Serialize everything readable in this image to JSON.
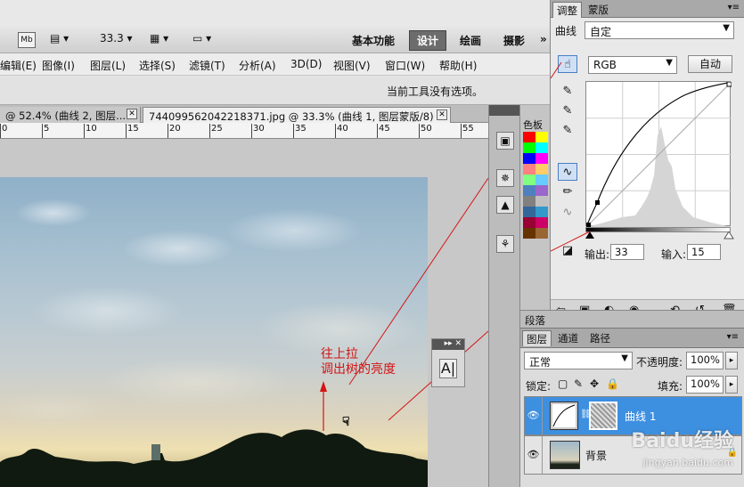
{
  "app": {
    "mb_badge": "Mb",
    "zoom": "33.3",
    "workspaces": [
      "基本功能",
      "设计",
      "绘画",
      "摄影"
    ],
    "active_workspace": "设计",
    "more": "»"
  },
  "menu": [
    "编辑(E)",
    "图像(I)",
    "图层(L)",
    "选择(S)",
    "滤镜(T)",
    "分析(A)",
    "3D(D)",
    "视图(V)",
    "窗口(W)",
    "帮助(H)"
  ],
  "options_bar": {
    "message": "当前工具没有选项。"
  },
  "doc_tabs": [
    {
      "label": "@ 52.4% (曲线 2, 图层..."
    },
    {
      "label": "744099562042218371.jpg @ 33.3% (曲线 1, 图层蒙版/8) *"
    }
  ],
  "ruler": [
    "0",
    "5",
    "10",
    "15",
    "20",
    "25",
    "30",
    "35",
    "40",
    "45",
    "50",
    "55"
  ],
  "annotation": {
    "line1": "往上拉",
    "line2": "调出树的亮度"
  },
  "swatches": {
    "label": "色板",
    "colors": [
      "#ff0000",
      "#ffff00",
      "#00ff00",
      "#00ffff",
      "#0000ff",
      "#ff00ff",
      "#ff8080",
      "#ffcc66",
      "#80ff80",
      "#66ccff",
      "#4f7fbf",
      "#9966cc",
      "#808080",
      "#c0c0c0",
      "#336699",
      "#3399cc",
      "#990033",
      "#cc0066",
      "#663300",
      "#996633"
    ]
  },
  "char_panel": {
    "glyph": "A|"
  },
  "adjustments": {
    "tabs": [
      "调整",
      "蒙版"
    ],
    "active_tab": "调整",
    "preset_label": "曲线",
    "preset_value": "自定",
    "channel": "RGB",
    "auto_button": "自动",
    "output_label": "输出:",
    "output_value": "33",
    "input_label": "输入:",
    "input_value": "15"
  },
  "paragraph_panel": {
    "label": "段落"
  },
  "layers": {
    "tabs": [
      "图层",
      "通道",
      "路径"
    ],
    "blend_mode": "正常",
    "opacity_label": "不透明度:",
    "opacity_value": "100%",
    "lock_label": "锁定:",
    "fill_label": "填充:",
    "fill_value": "100%",
    "items": [
      {
        "name": "曲线 1",
        "selected": true
      },
      {
        "name": "背景",
        "selected": false
      }
    ]
  },
  "watermark": {
    "brand": "Baidu经验",
    "url": "jingyan.baidu.com"
  }
}
